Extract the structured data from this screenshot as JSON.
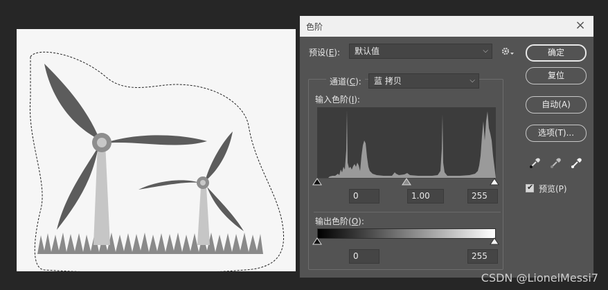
{
  "dialog": {
    "title": "色阶",
    "close_glyph": "×",
    "preset_label": "预设(",
    "preset_key": "E",
    "preset_suffix": "):",
    "preset_value": "默认值",
    "channel_label": "通道(",
    "channel_key": "C",
    "channel_suffix": "):",
    "channel_value": "蓝 拷贝",
    "input_levels_label": "输入色阶(",
    "input_levels_key": "I",
    "input_levels_suffix": "):",
    "input_black": "0",
    "input_gamma": "1.00",
    "input_white": "255",
    "output_levels_label": "输出色阶(",
    "output_levels_key": "O",
    "output_levels_suffix": "):",
    "output_black": "0",
    "output_white": "255",
    "input_black_level": 0,
    "input_gamma_level": 128,
    "input_white_level": 255,
    "output_black_level": 0,
    "output_white_level": 255
  },
  "buttons": {
    "ok": "确定",
    "reset": "复位",
    "auto": "自动(A)",
    "options": "选项(T)..."
  },
  "preview": {
    "label": "预览(P)",
    "checked": true
  },
  "icons": {
    "gear": "gear-icon",
    "black_dropper": "black-point-eyedropper-icon",
    "gray_dropper": "gray-point-eyedropper-icon",
    "white_dropper": "white-point-eyedropper-icon"
  },
  "watermark": "CSDN @LionelMessi7"
}
